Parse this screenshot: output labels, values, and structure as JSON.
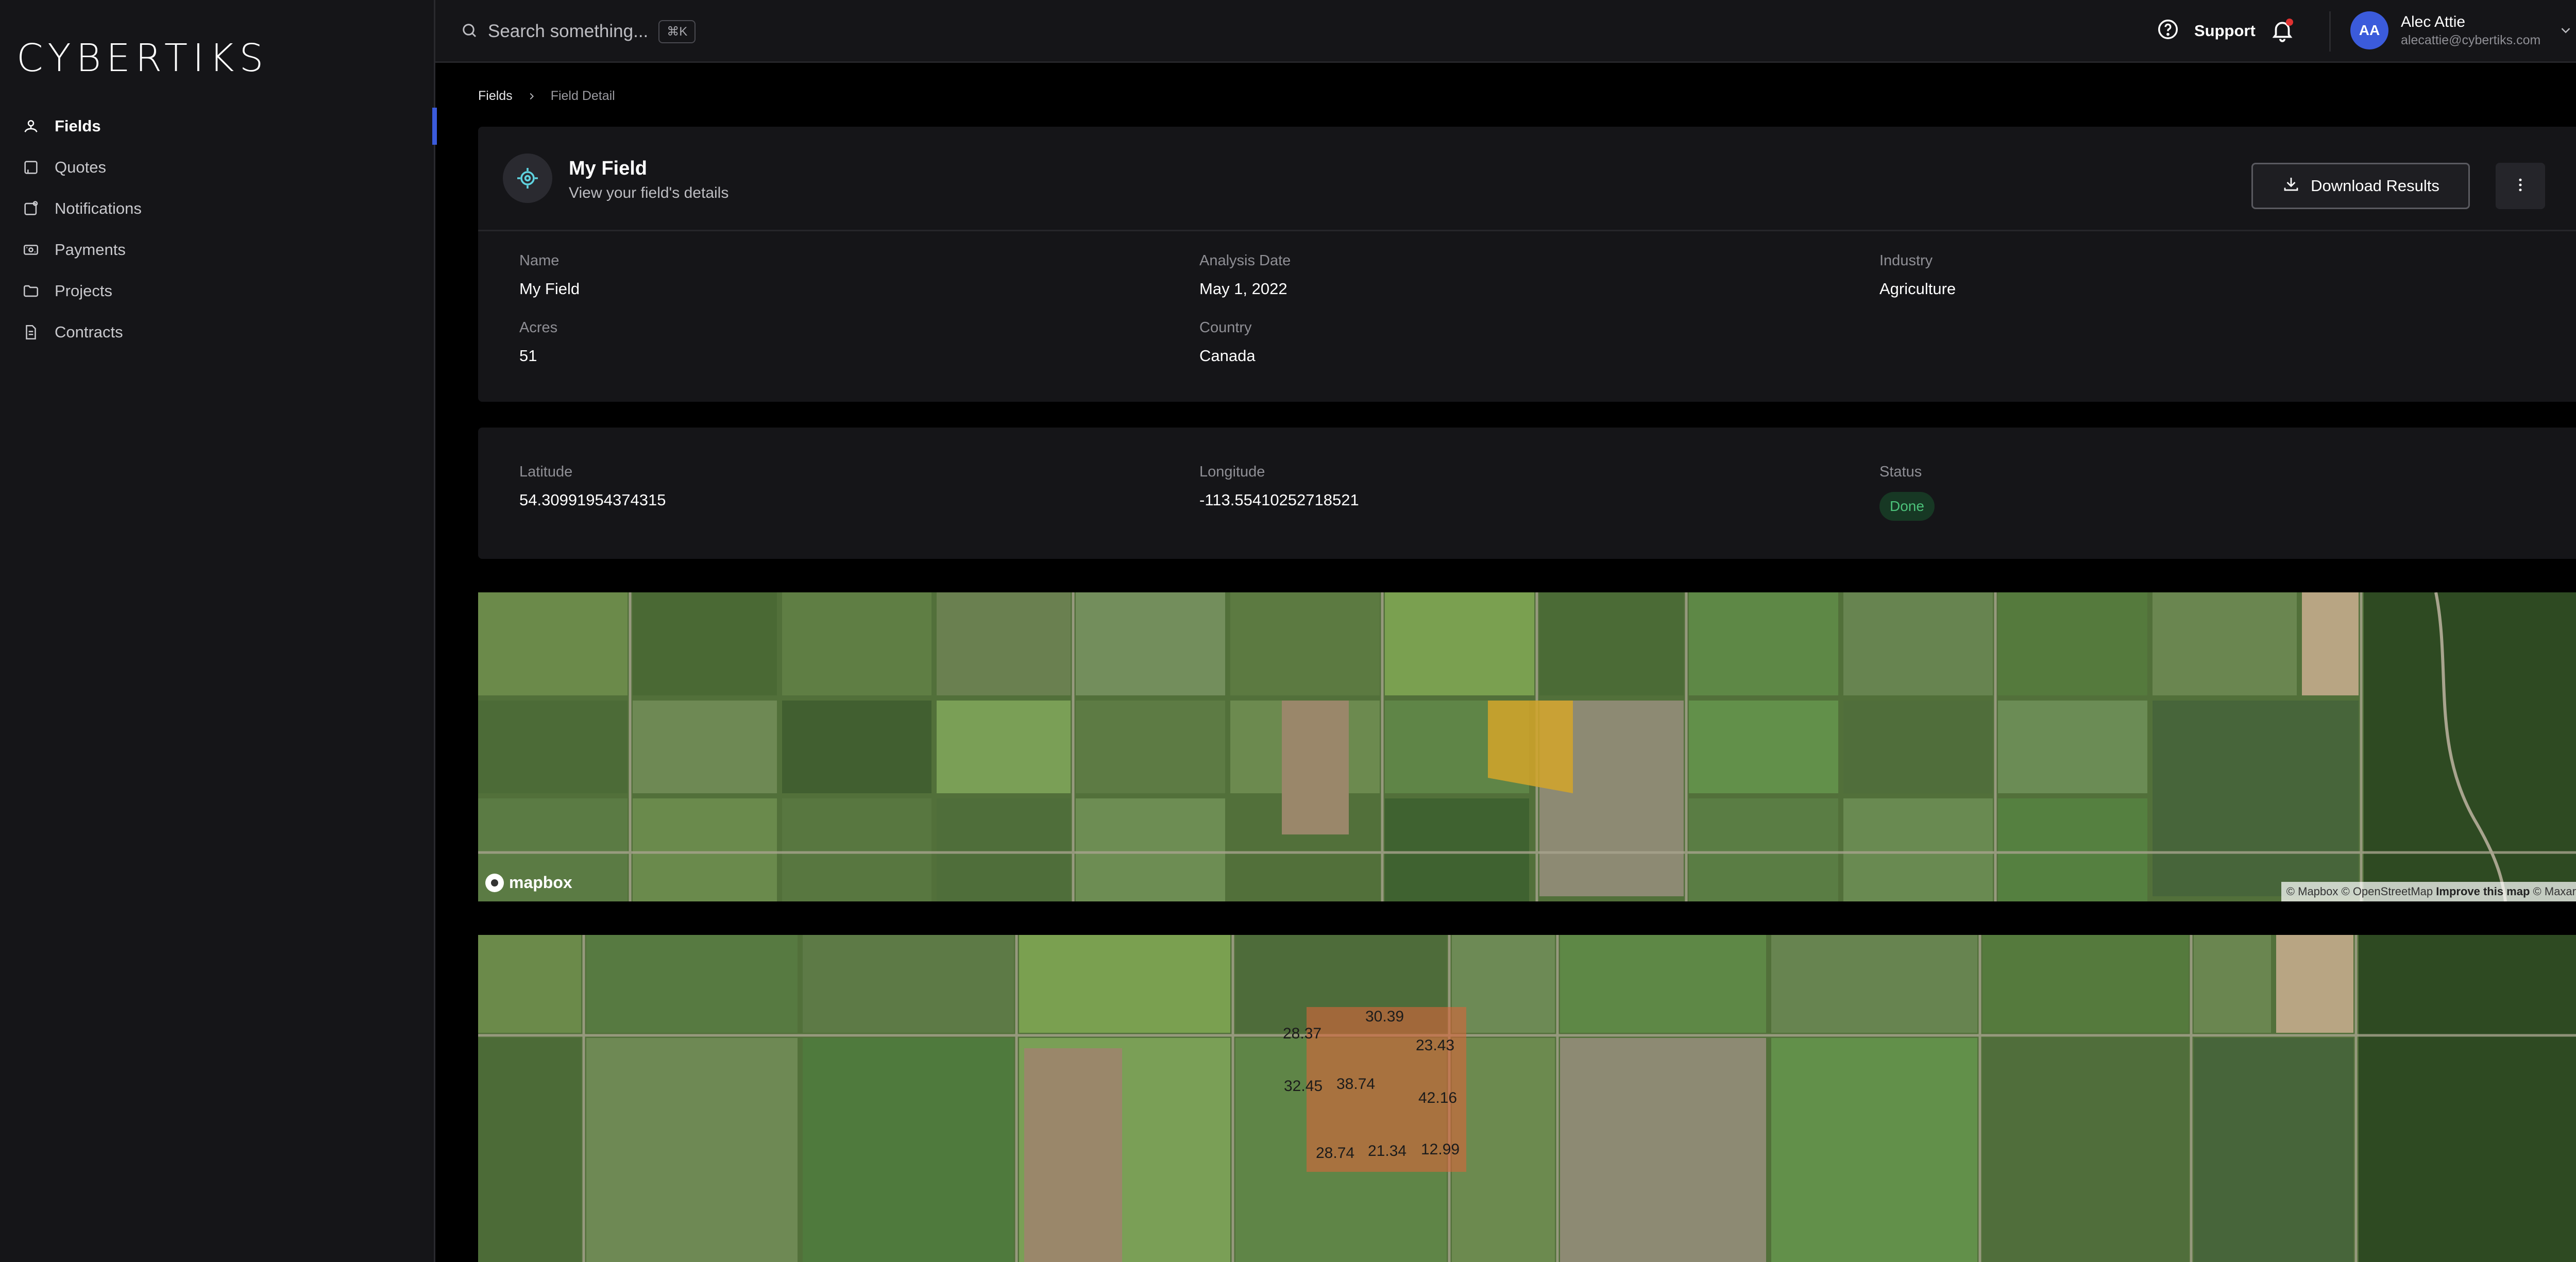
{
  "brand": {
    "name": "CYBERTIKS"
  },
  "sidebar": {
    "items": [
      {
        "label": "Fields",
        "icon": "fields-icon",
        "active": true
      },
      {
        "label": "Quotes",
        "icon": "quotes-icon",
        "active": false
      },
      {
        "label": "Notifications",
        "icon": "notifications-icon",
        "active": false
      },
      {
        "label": "Payments",
        "icon": "payments-icon",
        "active": false
      },
      {
        "label": "Projects",
        "icon": "projects-icon",
        "active": false
      },
      {
        "label": "Contracts",
        "icon": "contracts-icon",
        "active": false
      }
    ]
  },
  "topbar": {
    "search_placeholder": "Search something...",
    "search_shortcut": "⌘K",
    "support_label": "Support",
    "user": {
      "initials": "AA",
      "name": "Alec Attie",
      "email": "alecattie@cybertiks.com"
    }
  },
  "breadcrumb": {
    "parent": "Fields",
    "current": "Field Detail"
  },
  "field": {
    "title": "My Field",
    "subtitle": "View your field's details",
    "download_label": "Download Results",
    "details": {
      "name_label": "Name",
      "name": "My Field",
      "analysis_date_label": "Analysis Date",
      "analysis_date": "May 1, 2022",
      "industry_label": "Industry",
      "industry": "Agriculture",
      "acres_label": "Acres",
      "acres": "51",
      "country_label": "Country",
      "country": "Canada"
    },
    "location": {
      "latitude_label": "Latitude",
      "latitude": "54.30991954374315",
      "longitude_label": "Longitude",
      "longitude": "-113.55410252718521",
      "status_label": "Status",
      "status": "Done"
    }
  },
  "map1": {
    "logo_text": "mapbox",
    "attribution_1": "© Mapbox © OpenStreetMap",
    "attribution_link": "Improve this map",
    "attribution_2": "© Maxar"
  },
  "map2": {
    "values": [
      "30.39",
      "28.37",
      "23.43",
      "32.45",
      "38.74",
      "42.16",
      "28.74",
      "21.34",
      "12.99"
    ]
  },
  "colors": {
    "accent": "#3b5bdb",
    "status_done_bg": "#173824",
    "status_done_text": "#4cc27a",
    "field_highlight": "#d4a52a",
    "heatmap": "#d9653b"
  }
}
